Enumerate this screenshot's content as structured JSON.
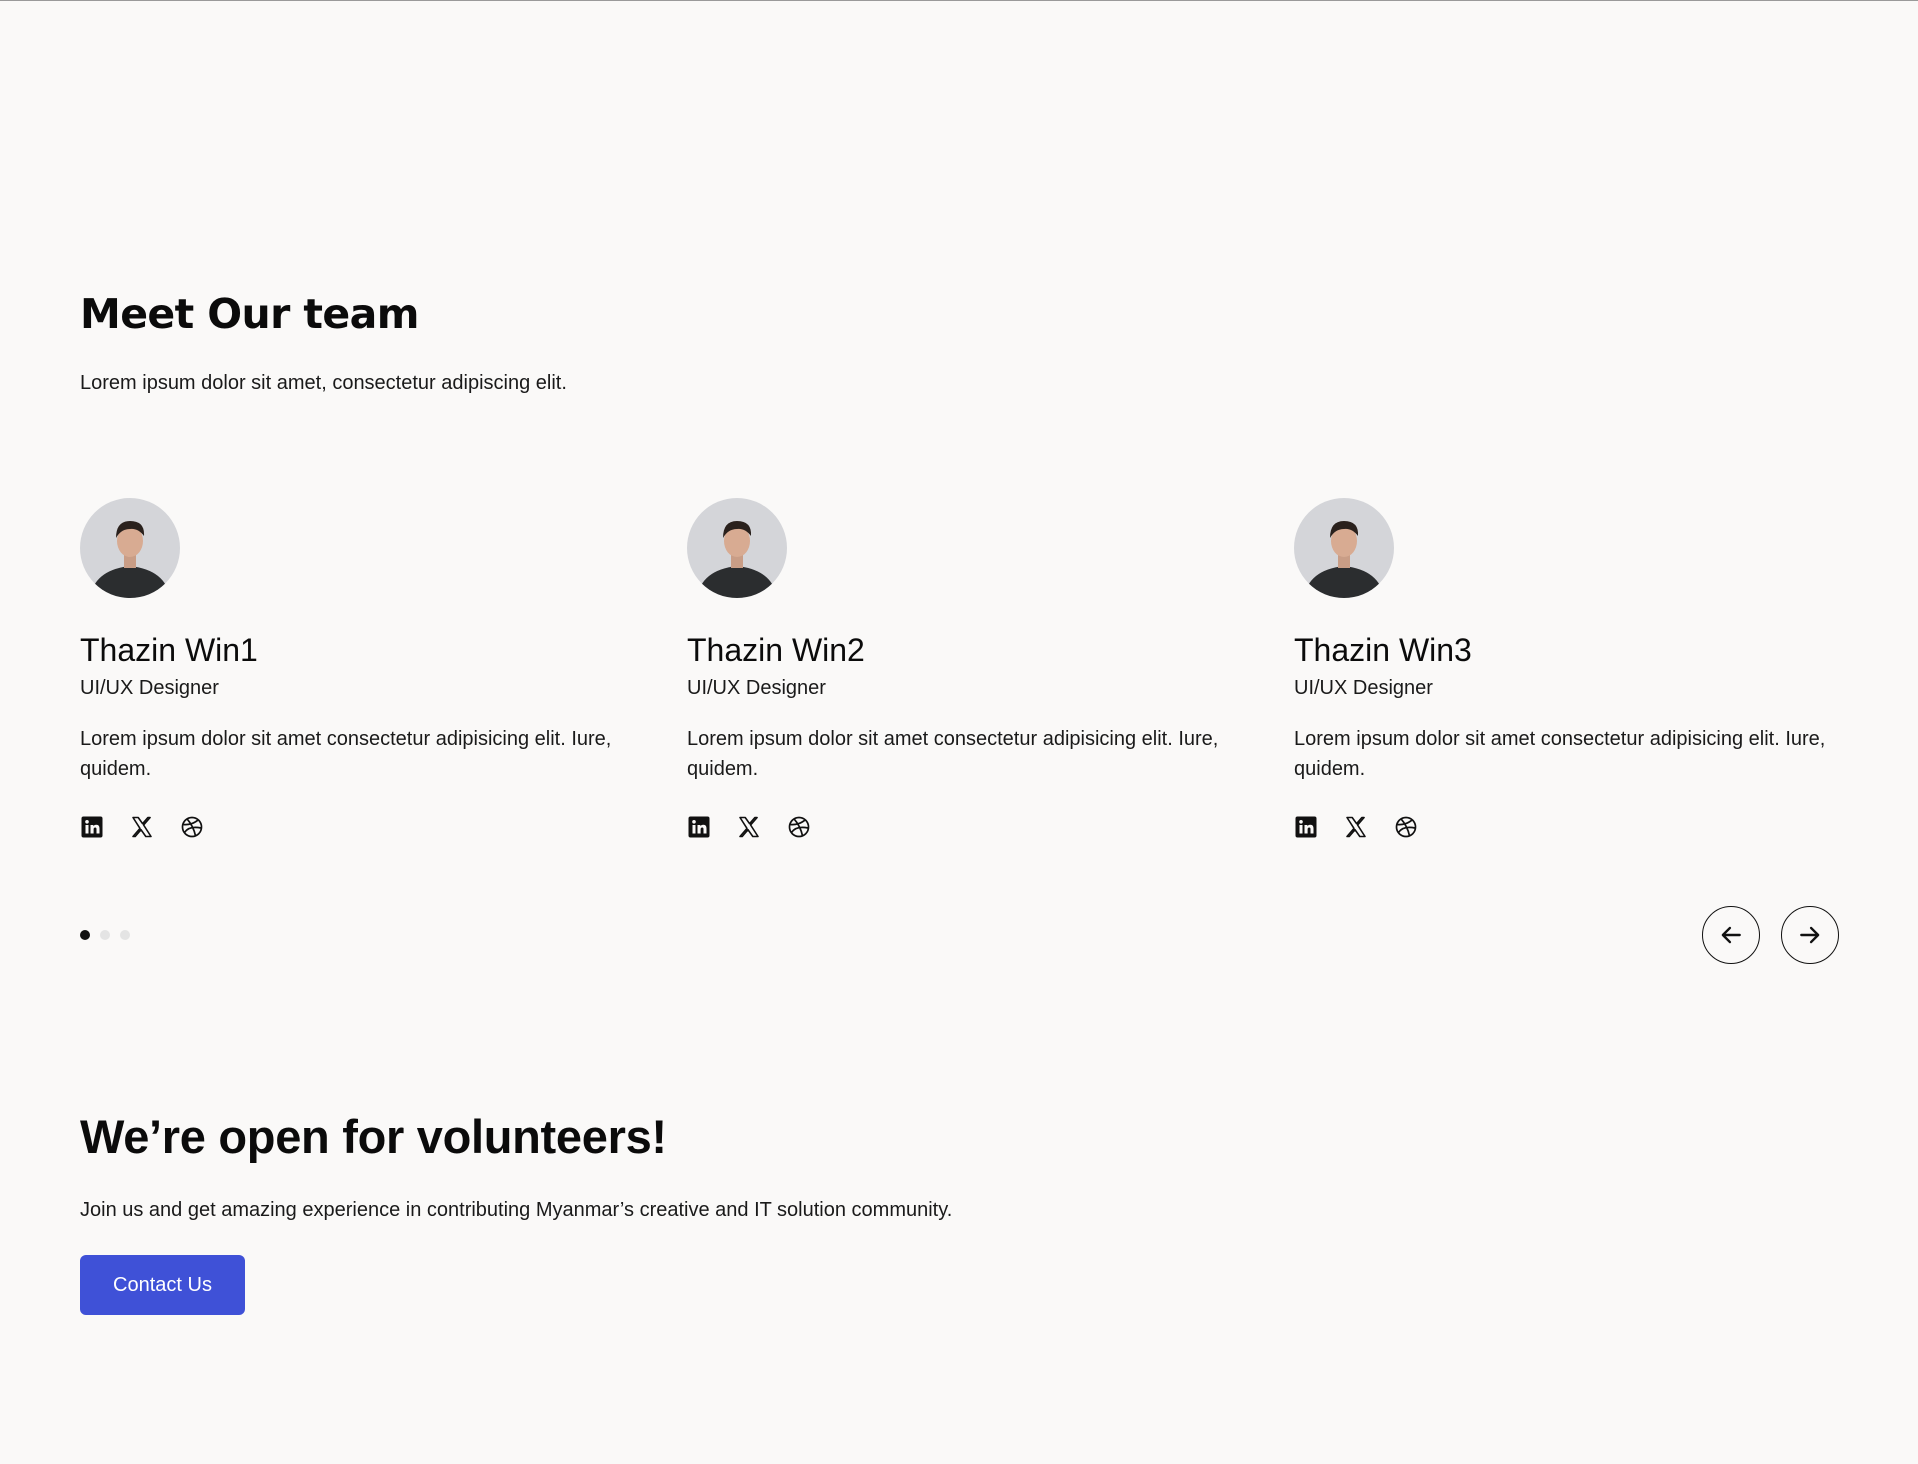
{
  "team": {
    "title": "Meet Our team",
    "subtitle": "Lorem ipsum dolor sit amet, consectetur adipiscing elit.",
    "members": [
      {
        "name": "Thazin Win1",
        "role": "UI/UX Designer",
        "bio": "Lorem ipsum dolor sit amet consectetur adipisicing elit. Iure, quidem.",
        "socials": [
          "linkedin-icon",
          "x-icon",
          "dribbble-icon"
        ]
      },
      {
        "name": "Thazin Win2",
        "role": "UI/UX Designer",
        "bio": "Lorem ipsum dolor sit amet consectetur adipisicing elit. Iure, quidem.",
        "socials": [
          "linkedin-icon",
          "x-icon",
          "dribbble-icon"
        ]
      },
      {
        "name": "Thazin Win3",
        "role": "UI/UX Designer",
        "bio": "Lorem ipsum dolor sit amet consectetur adipisicing elit. Iure, quidem.",
        "socials": [
          "linkedin-icon",
          "x-icon",
          "dribbble-icon"
        ]
      }
    ]
  },
  "carousel": {
    "page_count": 3,
    "active_page": 1,
    "prev_icon": "arrow-left-icon",
    "next_icon": "arrow-right-icon"
  },
  "volunteer": {
    "title": "We’re open for volunteers!",
    "text": "Join us and get amazing experience in contributing Myanmar’s creative and IT solution community.",
    "button_label": "Contact Us"
  },
  "colors": {
    "background": "#faf9f8",
    "text": "#111111",
    "accent": "#3f51d7",
    "dot_active": "#111111",
    "dot_inactive": "#e4e4e4"
  }
}
